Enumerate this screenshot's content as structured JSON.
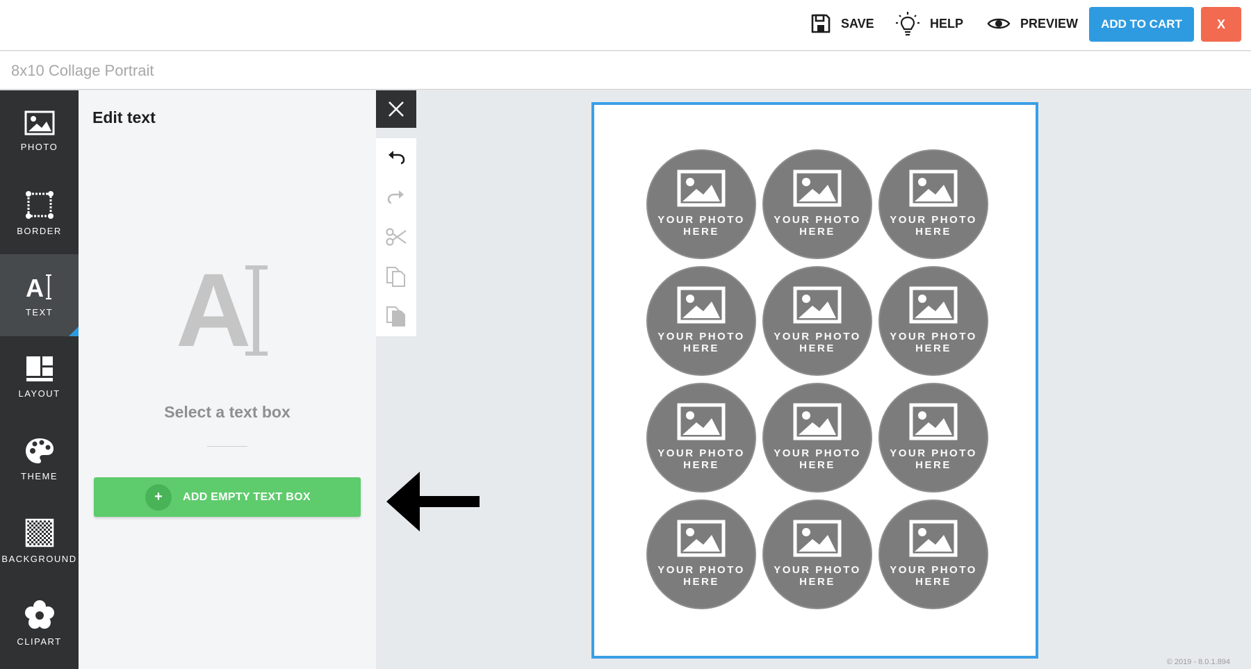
{
  "header": {
    "save_label": "SAVE",
    "help_label": "HELP",
    "preview_label": "PREVIEW",
    "cart_label": "ADD TO CART",
    "close_label": "X",
    "colors": {
      "cart": "#2e9be0",
      "close": "#f26a4f"
    }
  },
  "project": {
    "title": "8x10 Collage Portrait"
  },
  "sidebar": {
    "items": [
      {
        "label": "PHOTO",
        "icon": "photo-icon"
      },
      {
        "label": "BORDER",
        "icon": "border-icon"
      },
      {
        "label": "TEXT",
        "icon": "text-icon",
        "active": true
      },
      {
        "label": "LAYOUT",
        "icon": "layout-icon"
      },
      {
        "label": "THEME",
        "icon": "palette-icon"
      },
      {
        "label": "BACKGROUND",
        "icon": "checkerboard-icon"
      },
      {
        "label": "CLIPART",
        "icon": "flower-icon"
      }
    ]
  },
  "panel": {
    "title": "Edit text",
    "hint": "Select a text box",
    "add_button_label": "ADD EMPTY TEXT BOX",
    "add_button_symbol": "+",
    "accent": "#5ecb6c"
  },
  "toolbar": {
    "tools": [
      "undo-icon",
      "redo-icon",
      "cut-icon",
      "copy-icon",
      "paste-icon"
    ]
  },
  "canvas": {
    "slot_label": "YOUR PHOTO HERE",
    "slots": [
      "YOUR PHOTO HERE",
      "YOUR PHOTO HERE",
      "YOUR PHOTO HERE",
      "YOUR PHOTO HERE",
      "YOUR PHOTO HERE",
      "YOUR PHOTO HERE",
      "YOUR PHOTO HERE",
      "YOUR PHOTO HERE",
      "YOUR PHOTO HERE",
      "YOUR PHOTO HERE",
      "YOUR PHOTO HERE",
      "YOUR PHOTO HERE"
    ],
    "border_color": "#3a9fe6"
  },
  "footer": {
    "copyright": "© 2019 - 8.0.1.894"
  }
}
